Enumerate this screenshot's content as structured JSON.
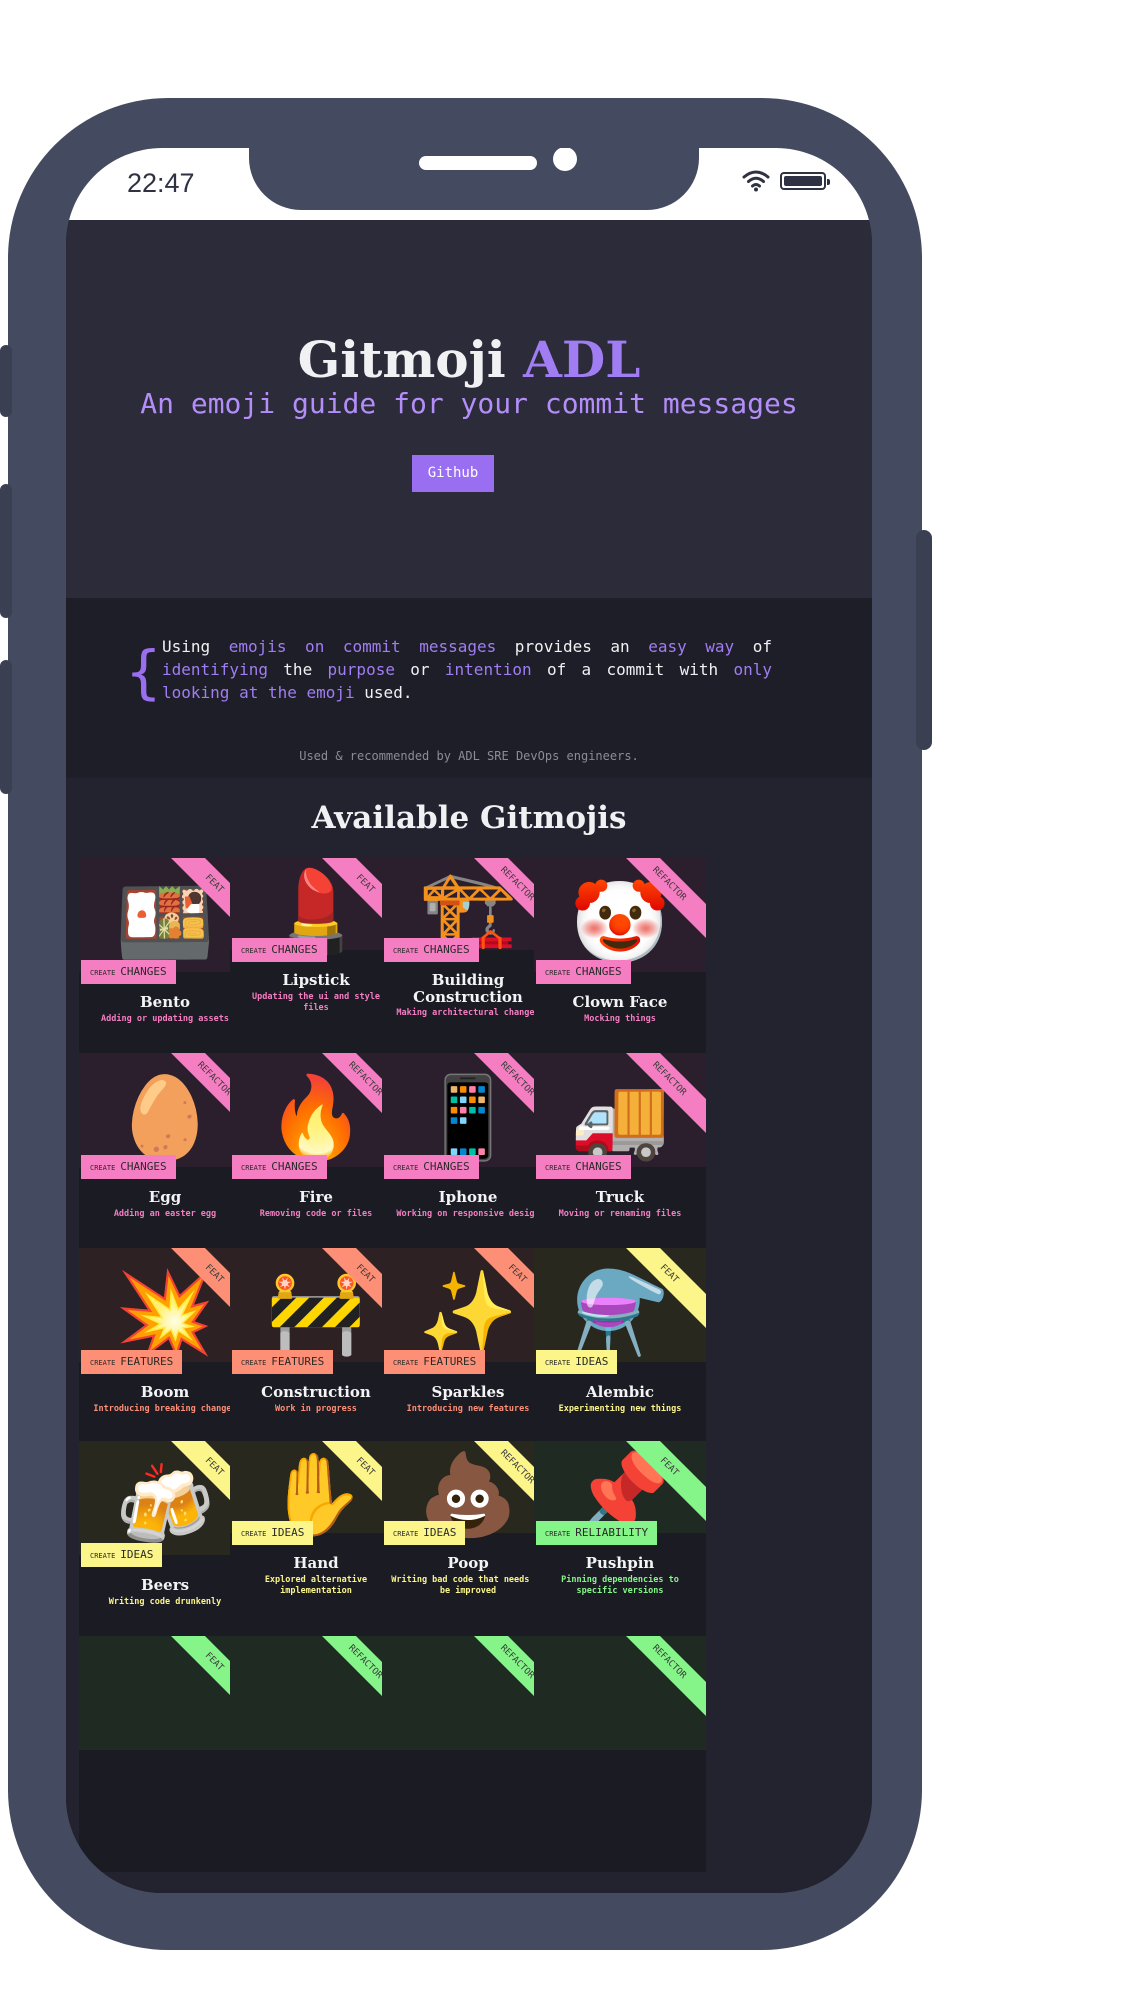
{
  "status_bar": {
    "time": "22:47"
  },
  "header": {
    "title_main": "Gitmoji",
    "title_accent": "ADL",
    "subtitle": "An emoji guide for your commit messages",
    "github_button": "Github"
  },
  "about": {
    "p1": "Using ",
    "h1": "emojis on commit messages",
    "p2": " provides an ",
    "h2": "easy way",
    "p3": " of ",
    "h3": "identifying",
    "p4": " the ",
    "h4": "purpose",
    "p5": " or ",
    "h5": "intention",
    "p6": " of a commit with ",
    "h6": "only looking at the emoji",
    "p7": " used.",
    "credit": "Used & recommended by ADL SRE DevOps engineers."
  },
  "section_title": "Available Gitmojis",
  "colors": {
    "changes": "#f47ec1",
    "features": "#fc8f76",
    "ideas": "#fbf58a",
    "reliability": "#86f589",
    "accent": "#a07df2"
  },
  "cards": [
    {
      "emoji": "🍱",
      "ribbon": "FEAT",
      "tag_small": "CREATE",
      "tag": "CHANGES",
      "name": "Bento",
      "desc": "Adding or updating assets",
      "code": ":bento:"
    },
    {
      "emoji": "💄",
      "ribbon": "FEAT",
      "tag_small": "CREATE",
      "tag": "CHANGES",
      "name": "Lipstick",
      "desc": "Updating the ui and style files",
      "code": ":lipstick:"
    },
    {
      "emoji": "🏗️",
      "ribbon": "REFACTOR",
      "tag_small": "CREATE",
      "tag": "CHANGES",
      "name": "Building Construction",
      "desc": "Making architectural changes",
      "code": ":building_construction:"
    },
    {
      "emoji": "🤡",
      "ribbon": "REFACTOR",
      "tag_small": "CREATE",
      "tag": "CHANGES",
      "name": "Clown Face",
      "desc": "Mocking things",
      "code": ":clown_face:"
    },
    {
      "emoji": "🥚",
      "ribbon": "REFACTOR",
      "tag_small": "CREATE",
      "tag": "CHANGES",
      "name": "Egg",
      "desc": "Adding an easter egg",
      "code": ":egg:"
    },
    {
      "emoji": "🔥",
      "ribbon": "REFACTOR",
      "tag_small": "CREATE",
      "tag": "CHANGES",
      "name": "Fire",
      "desc": "Removing code or files",
      "code": ":fire:"
    },
    {
      "emoji": "📱",
      "ribbon": "REFACTOR",
      "tag_small": "CREATE",
      "tag": "CHANGES",
      "name": "Iphone",
      "desc": "Working on responsive design",
      "code": ":iphone:"
    },
    {
      "emoji": "🚚",
      "ribbon": "REFACTOR",
      "tag_small": "CREATE",
      "tag": "CHANGES",
      "name": "Truck",
      "desc": "Moving or renaming files",
      "code": ":truck:"
    },
    {
      "emoji": "💥",
      "ribbon": "FEAT",
      "tag_small": "CREATE",
      "tag": "FEATURES",
      "name": "Boom",
      "desc": "Introducing breaking changes",
      "code": ":boom:"
    },
    {
      "emoji": "🚧",
      "ribbon": "FEAT",
      "tag_small": "CREATE",
      "tag": "FEATURES",
      "name": "Construction",
      "desc": "Work in progress",
      "code": ":construction:"
    },
    {
      "emoji": "✨",
      "ribbon": "FEAT",
      "tag_small": "CREATE",
      "tag": "FEATURES",
      "name": "Sparkles",
      "desc": "Introducing new features",
      "code": ":sparkles:"
    },
    {
      "emoji": "⚗️",
      "ribbon": "FEAT",
      "tag_small": "CREATE",
      "tag": "IDEAS",
      "name": "Alembic",
      "desc": "Experimenting new things",
      "code": ":alembic:"
    },
    {
      "emoji": "🍻",
      "ribbon": "FEAT",
      "tag_small": "CREATE",
      "tag": "IDEAS",
      "name": "Beers",
      "desc": "Writing code drunkenly",
      "code": ":beers:"
    },
    {
      "emoji": "✋",
      "ribbon": "FEAT",
      "tag_small": "CREATE",
      "tag": "IDEAS",
      "name": "Hand",
      "desc": "Explored alternative implementation",
      "code": ":hand:"
    },
    {
      "emoji": "💩",
      "ribbon": "REFACTOR",
      "tag_small": "CREATE",
      "tag": "IDEAS",
      "name": "Poop",
      "desc": "Writing bad code that needs to be improved",
      "code": ":poop:"
    },
    {
      "emoji": "📌",
      "ribbon": "FEAT",
      "tag_small": "CREATE",
      "tag": "RELIABILITY",
      "name": "Pushpin",
      "desc": "Pinning dependencies to specific versions",
      "code": ":pushpin:"
    },
    {
      "emoji": "",
      "ribbon": "FEAT",
      "tag_small": "",
      "tag": "",
      "name": "",
      "desc": "",
      "code": ""
    },
    {
      "emoji": "",
      "ribbon": "REFACTOR",
      "tag_small": "",
      "tag": "",
      "name": "",
      "desc": "",
      "code": ""
    },
    {
      "emoji": "",
      "ribbon": "REFACTOR",
      "tag_small": "",
      "tag": "",
      "name": "",
      "desc": "",
      "code": ""
    },
    {
      "emoji": "",
      "ribbon": "REFACTOR",
      "tag_small": "",
      "tag": "",
      "name": "",
      "desc": "",
      "code": ""
    }
  ]
}
